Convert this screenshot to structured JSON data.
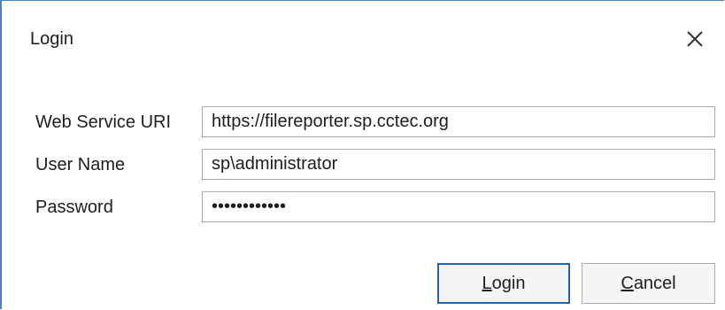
{
  "dialog": {
    "title": "Login",
    "close_icon": "close-icon"
  },
  "form": {
    "web_service_uri": {
      "label": "Web Service URI",
      "value": "https://filereporter.sp.cctec.org"
    },
    "user_name": {
      "label": "User Name",
      "value": "sp\\administrator"
    },
    "password": {
      "label": "Password",
      "value": "••••••••••••"
    }
  },
  "buttons": {
    "login": {
      "mnemonic": "L",
      "rest": "ogin"
    },
    "cancel": {
      "mnemonic": "C",
      "rest": "ancel"
    }
  },
  "colors": {
    "window_border": "#4f7fbf",
    "default_button_border": "#2b5fa8",
    "input_border": "#ababab"
  }
}
